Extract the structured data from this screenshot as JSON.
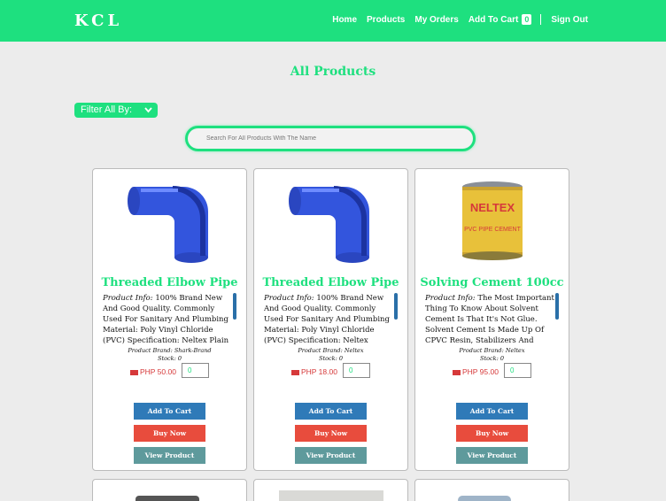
{
  "brand": "KCL",
  "nav": {
    "home": "Home",
    "products": "Products",
    "orders": "My Orders",
    "cart": "Add To Cart",
    "cart_count": "0",
    "signout": "Sign Out"
  },
  "page_title": "All Products",
  "filter": {
    "label": "Filter All By:"
  },
  "search": {
    "placeholder": "Search For All Products With The Name"
  },
  "products": [
    {
      "name": "Threaded Elbow Pipe",
      "info_label": "Product Info:",
      "info": "100% Brand New And Good Quality. Commonly Used For Sanitary And Plumbing Material: Poly Vinyl Chloride (PVC) Specification: Neltex Plain",
      "brand": "Product Brand: Shark-Brand",
      "stock": "Stock: 0",
      "price": "PHP 50.00",
      "qty": "0",
      "image": "blue-elbow-pipe",
      "add_label": "Add To Cart",
      "buy_label": "Buy Now",
      "view_label": "View Product"
    },
    {
      "name": "Threaded Elbow Pipe",
      "info_label": "Product Info:",
      "info": "100% Brand New And Good Quality. Commonly Used For Sanitary And Plumbing Material: Poly Vinyl Chloride (PVC) Specification: Neltex",
      "brand": "Product Brand: Neltex",
      "stock": "Stock: 0",
      "price": "PHP 18.00",
      "qty": "0",
      "image": "blue-elbow-pipe",
      "add_label": "Add To Cart",
      "buy_label": "Buy Now",
      "view_label": "View Product"
    },
    {
      "name": "Solving Cement 100cc",
      "info_label": "Product Info:",
      "info": "The Most Important Thing To Know About Solvent Cement Is That It's Not Glue. Solvent Cement Is Made Up Of CPVC Resin, Stabilizers And",
      "brand": "Product Brand: Neltex",
      "stock": "Stock: 0",
      "price": "PHP 95.00",
      "qty": "0",
      "image": "neltex-cement-can",
      "can_text": "NELTEX",
      "can_sub": "PVC PIPE CEMENT",
      "add_label": "Add To Cart",
      "buy_label": "Buy Now",
      "view_label": "View Product"
    }
  ],
  "colors": {
    "accent": "#1ee07f",
    "add": "#2f7ab8",
    "buy": "#e84c3d",
    "view": "#5e9a9c",
    "price": "#d6393a"
  }
}
